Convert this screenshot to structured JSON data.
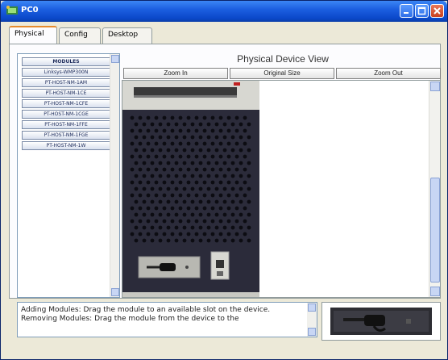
{
  "window": {
    "title": "PC0"
  },
  "tabs": [
    {
      "label": "Physical",
      "active": true
    },
    {
      "label": "Config",
      "active": false
    },
    {
      "label": "Desktop",
      "active": false
    }
  ],
  "modules": {
    "header": "MODULES",
    "items": [
      "Linksys-WMP300N",
      "PT-HOST-NM-1AM",
      "PT-HOST-NM-1CE",
      "PT-HOST-NM-1CFE",
      "PT-HOST-NM-1CGE",
      "PT-HOST-NM-1FFE",
      "PT-HOST-NM-1FGE",
      "PT-HOST-NM-1W"
    ]
  },
  "physical_view": {
    "title": "Physical Device View",
    "zoom_in": "Zoom In",
    "original_size": "Original Size",
    "zoom_out": "Zoom Out"
  },
  "info": {
    "line1": "Adding Modules: Drag the module to an available slot on the device.",
    "line2": "Removing Modules: Drag the module from the device to the"
  },
  "colors": {
    "title_bar": "#1c5fe0",
    "device_body": "#2b2b3a",
    "device_frame": "#c8c8c2"
  }
}
